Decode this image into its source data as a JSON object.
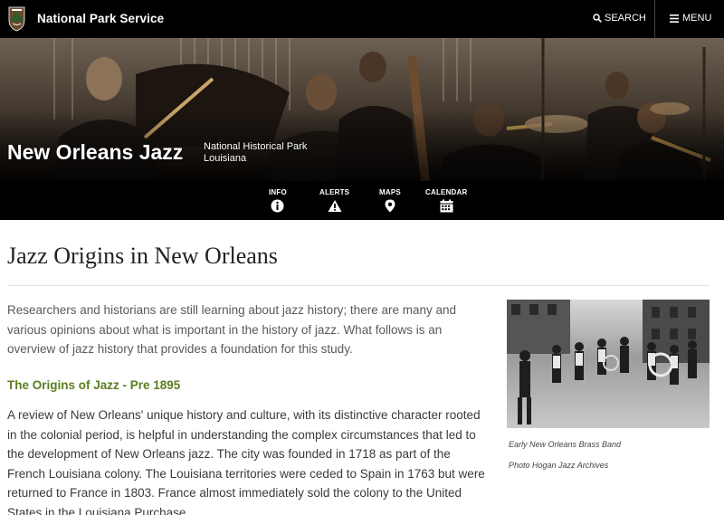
{
  "header": {
    "brand": "National Park Service",
    "search_label": "SEARCH",
    "menu_label": "MENU"
  },
  "hero": {
    "park_name": "New Orleans Jazz",
    "designation": "National Historical Park",
    "state": "Louisiana"
  },
  "subnav": {
    "items": [
      {
        "label": "INFO",
        "icon": "info-icon"
      },
      {
        "label": "ALERTS",
        "icon": "alert-icon"
      },
      {
        "label": "MAPS",
        "icon": "map-pin-icon"
      },
      {
        "label": "CALENDAR",
        "icon": "calendar-icon"
      }
    ]
  },
  "article": {
    "title": "Jazz Origins in New Orleans",
    "intro": "Researchers and historians are still learning about jazz history; there are many and various opinions about what is important in the history of jazz. What follows is an overview of jazz history that provides a foundation for this study.",
    "section_heading": "The Origins of Jazz - Pre 1895",
    "section_body": "A review of New Orleans' unique history and culture, with its distinctive character rooted in the colonial period, is helpful in understanding the complex circumstances that led to the development of New Orleans jazz. The city was founded in 1718 as part of the French Louisiana colony. The Louisiana territories were ceded to Spain in 1763 but were returned to France in 1803. France almost immediately sold the colony to the United States in the Louisiana Purchase."
  },
  "figure": {
    "caption": "Early New Orleans Brass Band",
    "credit": "Photo Hogan Jazz Archives"
  },
  "colors": {
    "header_bg": "#000000",
    "heading_green": "#5b7d1f",
    "text": "#3a3a3a"
  }
}
